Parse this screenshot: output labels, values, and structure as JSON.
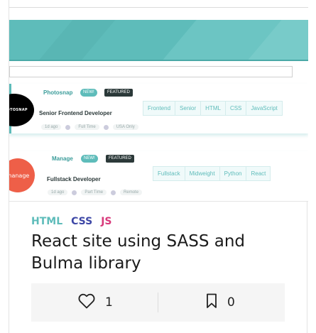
{
  "preview": {
    "jobs": [
      {
        "logo_text": "PHOTOSNAP",
        "company": "Photosnap",
        "new_badge": "NEW!",
        "featured_badge": "FEATURED",
        "position": "Senior Frontend Developer",
        "posted": "1d ago",
        "contract": "Full Time",
        "location": "USA Only",
        "tags": [
          "Frontend",
          "Senior",
          "HTML",
          "CSS",
          "JavaScript"
        ]
      },
      {
        "logo_text": "manage",
        "company": "Manage",
        "new_badge": "NEW!",
        "featured_badge": "FEATURED",
        "position": "Fullstack Developer",
        "posted": "1d ago",
        "contract": "Part Time",
        "location": "Remote",
        "tags": [
          "Fullstack",
          "Midweight",
          "Python",
          "React"
        ]
      }
    ],
    "colors": {
      "accent": "#5ebcba",
      "dark": "#2b3939"
    }
  },
  "post": {
    "languages": [
      {
        "label": "HTML",
        "color": "#5ebcba"
      },
      {
        "label": "CSS",
        "color": "#3d47a6"
      },
      {
        "label": "JS",
        "color": "#d8397a"
      }
    ],
    "title": "React site using SASS and Bulma library",
    "likes": "1",
    "saves": "0",
    "icons": {
      "like": "heart-icon",
      "save": "bookmark-icon"
    }
  }
}
